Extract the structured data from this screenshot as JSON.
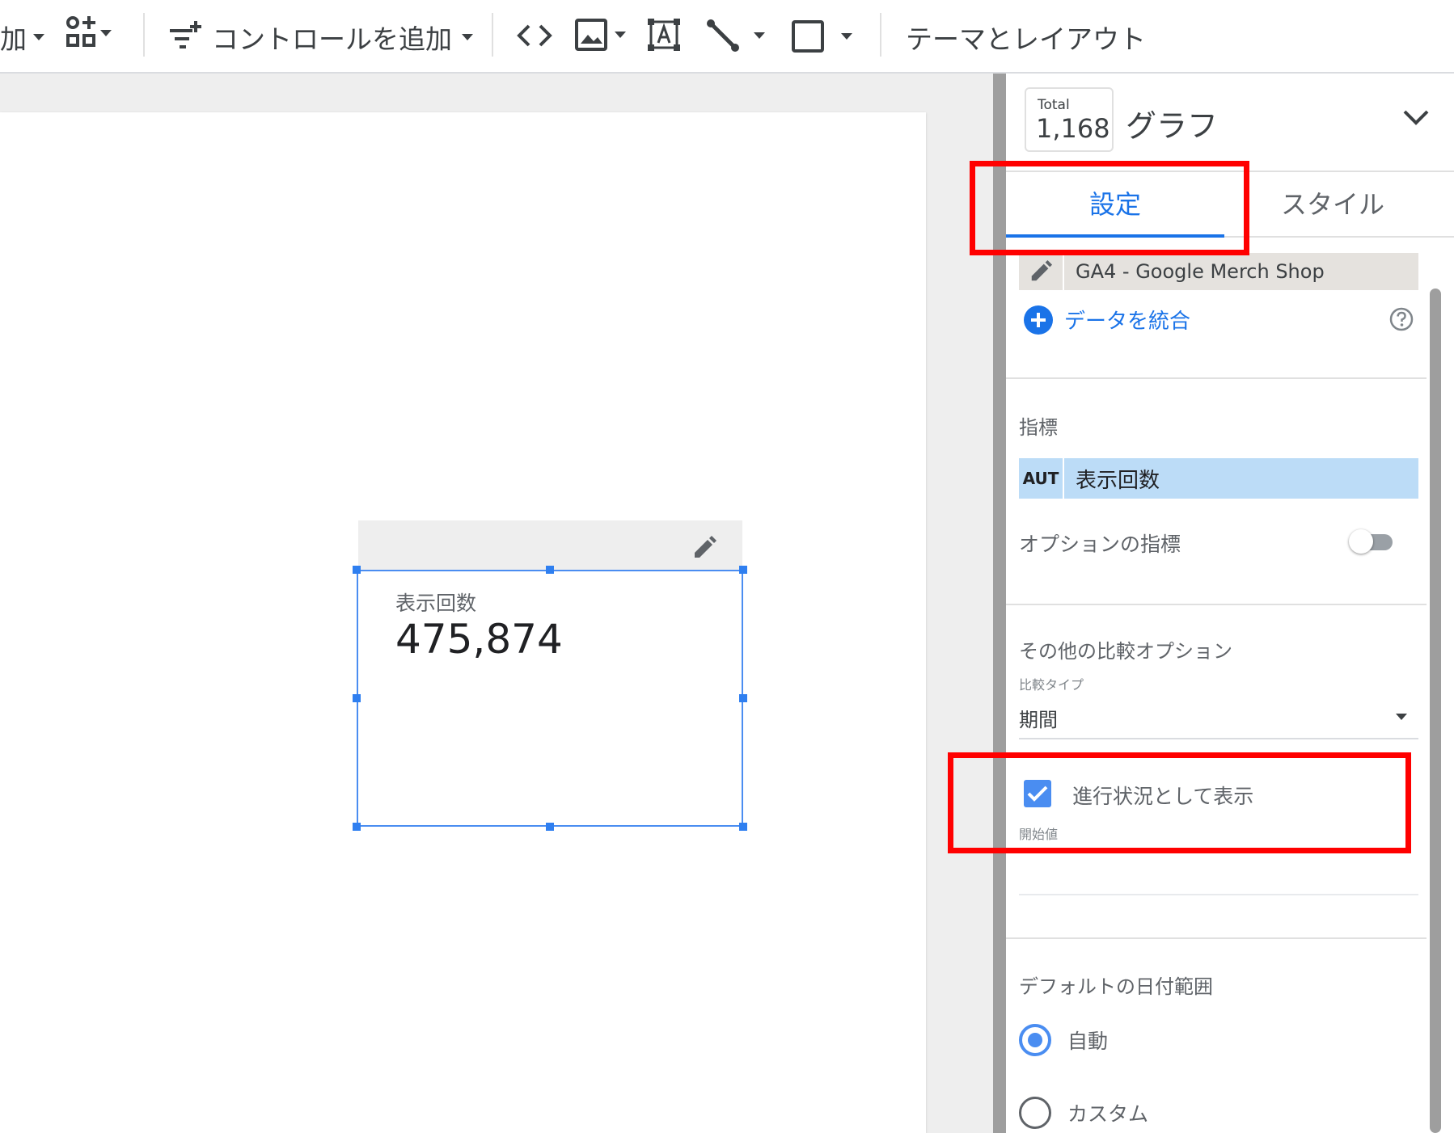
{
  "toolbar": {
    "add_partial_label": "加",
    "add_control_label": "コントロールを追加",
    "theme_layout_label": "テーマとレイアウト"
  },
  "canvas": {
    "scorecard": {
      "metric_label": "表示回数",
      "value": "475,874"
    }
  },
  "panel": {
    "total_label": "Total",
    "total_value": "1,168",
    "chart_title": "グラフ",
    "tabs": [
      "設定",
      "スタイル"
    ],
    "active_tab": "設定",
    "data_source": "GA4 - Google Merch Shop",
    "blend_label": "データを統合",
    "metrics_title": "指標",
    "metric_type": "AUT",
    "metric_name": "表示回数",
    "optional_metrics_label": "オプションの指標",
    "optional_metrics_enabled": false,
    "comparison_title": "その他の比較オプション",
    "comparison_type_label": "比較タイプ",
    "comparison_type_value": "期間",
    "show_progress_label": "進行状況として表示",
    "show_progress_checked": true,
    "start_value_label": "開始値",
    "default_date_title": "デフォルトの日付範囲",
    "date_options": [
      "自動",
      "カスタム"
    ],
    "date_selected": "自動"
  },
  "colors": {
    "accent": "#1a73e8",
    "selection": "#4a8df1",
    "annotation": "#ff0000",
    "metric_chip": "#bcdcf7"
  }
}
